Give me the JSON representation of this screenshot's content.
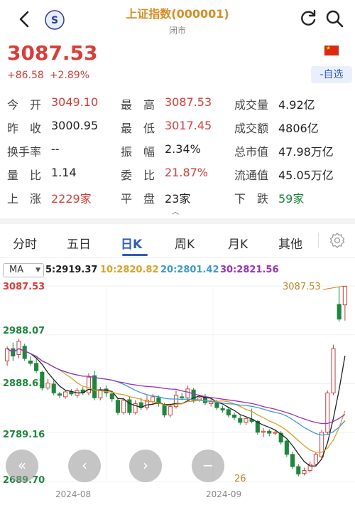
{
  "header": {
    "title": "上证指数(000001)",
    "subtitle": "闭市"
  },
  "quote": {
    "price": "3087.53",
    "change": "+86.58",
    "change_pct": "+2.89%",
    "add_watchlist": "-自选"
  },
  "stats": {
    "row1": {
      "l1": "今　开",
      "v1": "3049.10",
      "l2": "最　高",
      "v2": "3087.53",
      "l3": "成交量",
      "v3": "4.92亿"
    },
    "row2": {
      "l1": "昨　收",
      "v1": "3000.95",
      "l2": "最　低",
      "v2": "3017.45",
      "l3": "成交额",
      "v3": "4806亿"
    },
    "row3": {
      "l1": "换手率",
      "v1": "--",
      "l2": "振　幅",
      "v2": "2.34%",
      "l3": "总市值",
      "v3": "47.98万亿"
    },
    "row4": {
      "l1": "量　比",
      "v1": "1.14",
      "l2": "委　比",
      "v2": "21.87%",
      "l3": "流通值",
      "v3": "45.05万亿"
    },
    "row5": {
      "l1": "上　涨",
      "v1": "2229家",
      "l2": "平　盘",
      "v2": "23家",
      "l3": "下　跌",
      "v3": "59家"
    }
  },
  "tabs": [
    "分时",
    "五日",
    "日K",
    "周K",
    "月K",
    "其他"
  ],
  "active_tab": "日K",
  "ma": {
    "selector": "MA",
    "ma5": "5:2919.37",
    "ma10": "10:2820.82",
    "ma20": "20:2801.42",
    "ma30": "30:2821.56"
  },
  "colors": {
    "up": "#e03a36",
    "down": "#1a8a3a",
    "accent": "#2d5dbd",
    "ma5": "#222222",
    "ma10": "#e0a020",
    "ma20": "#3a9ad9",
    "ma30": "#9b30c0"
  },
  "chart_data": {
    "type": "candlestick",
    "y_labels": [
      "3087.53",
      "2988.07",
      "2888.61",
      "2789.16",
      "2689.70"
    ],
    "ylim": [
      2689.7,
      3087.53
    ],
    "x_labels": [
      "2024-08",
      "2024-09"
    ],
    "latest_price_tag": "3087.53",
    "partial_label": "26",
    "candles": [
      {
        "o": 2935,
        "c": 2960,
        "h": 2965,
        "l": 2925
      },
      {
        "o": 2960,
        "c": 2945,
        "h": 2972,
        "l": 2935
      },
      {
        "o": 2948,
        "c": 2975,
        "h": 2980,
        "l": 2940
      },
      {
        "o": 2965,
        "c": 2940,
        "h": 2970,
        "l": 2935
      },
      {
        "o": 2935,
        "c": 2930,
        "h": 2945,
        "l": 2925
      },
      {
        "o": 2930,
        "c": 2915,
        "h": 2940,
        "l": 2910
      },
      {
        "o": 2912,
        "c": 2880,
        "h": 2915,
        "l": 2875
      },
      {
        "o": 2880,
        "c": 2890,
        "h": 2898,
        "l": 2876
      },
      {
        "o": 2888,
        "c": 2870,
        "h": 2895,
        "l": 2865
      },
      {
        "o": 2868,
        "c": 2865,
        "h": 2872,
        "l": 2860
      },
      {
        "o": 2862,
        "c": 2872,
        "h": 2876,
        "l": 2858
      },
      {
        "o": 2872,
        "c": 2868,
        "h": 2878,
        "l": 2864
      },
      {
        "o": 2865,
        "c": 2875,
        "h": 2880,
        "l": 2860
      },
      {
        "o": 2876,
        "c": 2870,
        "h": 2882,
        "l": 2866
      },
      {
        "o": 2870,
        "c": 2902,
        "h": 2910,
        "l": 2865
      },
      {
        "o": 2905,
        "c": 2860,
        "h": 2915,
        "l": 2855
      },
      {
        "o": 2860,
        "c": 2875,
        "h": 2882,
        "l": 2855
      },
      {
        "o": 2878,
        "c": 2870,
        "h": 2885,
        "l": 2862
      },
      {
        "o": 2868,
        "c": 2858,
        "h": 2872,
        "l": 2852
      },
      {
        "o": 2855,
        "c": 2830,
        "h": 2860,
        "l": 2825
      },
      {
        "o": 2830,
        "c": 2855,
        "h": 2860,
        "l": 2826
      },
      {
        "o": 2856,
        "c": 2830,
        "h": 2862,
        "l": 2825
      },
      {
        "o": 2830,
        "c": 2848,
        "h": 2855,
        "l": 2826
      },
      {
        "o": 2850,
        "c": 2840,
        "h": 2860,
        "l": 2835
      },
      {
        "o": 2840,
        "c": 2855,
        "h": 2865,
        "l": 2835
      },
      {
        "o": 2852,
        "c": 2862,
        "h": 2868,
        "l": 2845
      },
      {
        "o": 2860,
        "c": 2848,
        "h": 2865,
        "l": 2842
      },
      {
        "o": 2845,
        "c": 2825,
        "h": 2850,
        "l": 2820
      },
      {
        "o": 2825,
        "c": 2842,
        "h": 2848,
        "l": 2820
      },
      {
        "o": 2842,
        "c": 2865,
        "h": 2875,
        "l": 2838
      },
      {
        "o": 2862,
        "c": 2860,
        "h": 2870,
        "l": 2855
      },
      {
        "o": 2860,
        "c": 2878,
        "h": 2885,
        "l": 2855
      },
      {
        "o": 2876,
        "c": 2855,
        "h": 2880,
        "l": 2850
      },
      {
        "o": 2856,
        "c": 2860,
        "h": 2866,
        "l": 2852
      },
      {
        "o": 2862,
        "c": 2850,
        "h": 2868,
        "l": 2845
      },
      {
        "o": 2848,
        "c": 2852,
        "h": 2858,
        "l": 2842
      },
      {
        "o": 2850,
        "c": 2840,
        "h": 2856,
        "l": 2835
      },
      {
        "o": 2838,
        "c": 2835,
        "h": 2844,
        "l": 2830
      },
      {
        "o": 2836,
        "c": 2825,
        "h": 2842,
        "l": 2820
      },
      {
        "o": 2825,
        "c": 2820,
        "h": 2830,
        "l": 2815
      },
      {
        "o": 2818,
        "c": 2810,
        "h": 2825,
        "l": 2805
      },
      {
        "o": 2810,
        "c": 2818,
        "h": 2822,
        "l": 2804
      },
      {
        "o": 2816,
        "c": 2812,
        "h": 2838,
        "l": 2808
      },
      {
        "o": 2812,
        "c": 2790,
        "h": 2815,
        "l": 2785
      },
      {
        "o": 2790,
        "c": 2792,
        "h": 2798,
        "l": 2780
      },
      {
        "o": 2792,
        "c": 2788,
        "h": 2796,
        "l": 2782
      },
      {
        "o": 2788,
        "c": 2790,
        "h": 2794,
        "l": 2784
      },
      {
        "o": 2788,
        "c": 2770,
        "h": 2792,
        "l": 2765
      },
      {
        "o": 2772,
        "c": 2745,
        "h": 2775,
        "l": 2740
      },
      {
        "o": 2745,
        "c": 2720,
        "h": 2750,
        "l": 2715
      },
      {
        "o": 2720,
        "c": 2705,
        "h": 2725,
        "l": 2700
      },
      {
        "o": 2706,
        "c": 2712,
        "h": 2718,
        "l": 2702
      },
      {
        "o": 2712,
        "c": 2725,
        "h": 2730,
        "l": 2708
      },
      {
        "o": 2725,
        "c": 2745,
        "h": 2750,
        "l": 2720
      },
      {
        "o": 2740,
        "c": 2790,
        "h": 2795,
        "l": 2735
      },
      {
        "o": 2790,
        "c": 2870,
        "h": 2875,
        "l": 2785
      },
      {
        "o": 2870,
        "c": 2960,
        "h": 2968,
        "l": 2865
      },
      {
        "o": 3050,
        "c": 3020,
        "h": 3085,
        "l": 3015
      },
      {
        "o": 3049,
        "c": 3087,
        "h": 3087,
        "l": 3017
      }
    ],
    "ma_series": [
      {
        "name": "5",
        "color_key": "ma5"
      },
      {
        "name": "10",
        "color_key": "ma10"
      },
      {
        "name": "20",
        "color_key": "ma20"
      },
      {
        "name": "30",
        "color_key": "ma30"
      }
    ]
  }
}
